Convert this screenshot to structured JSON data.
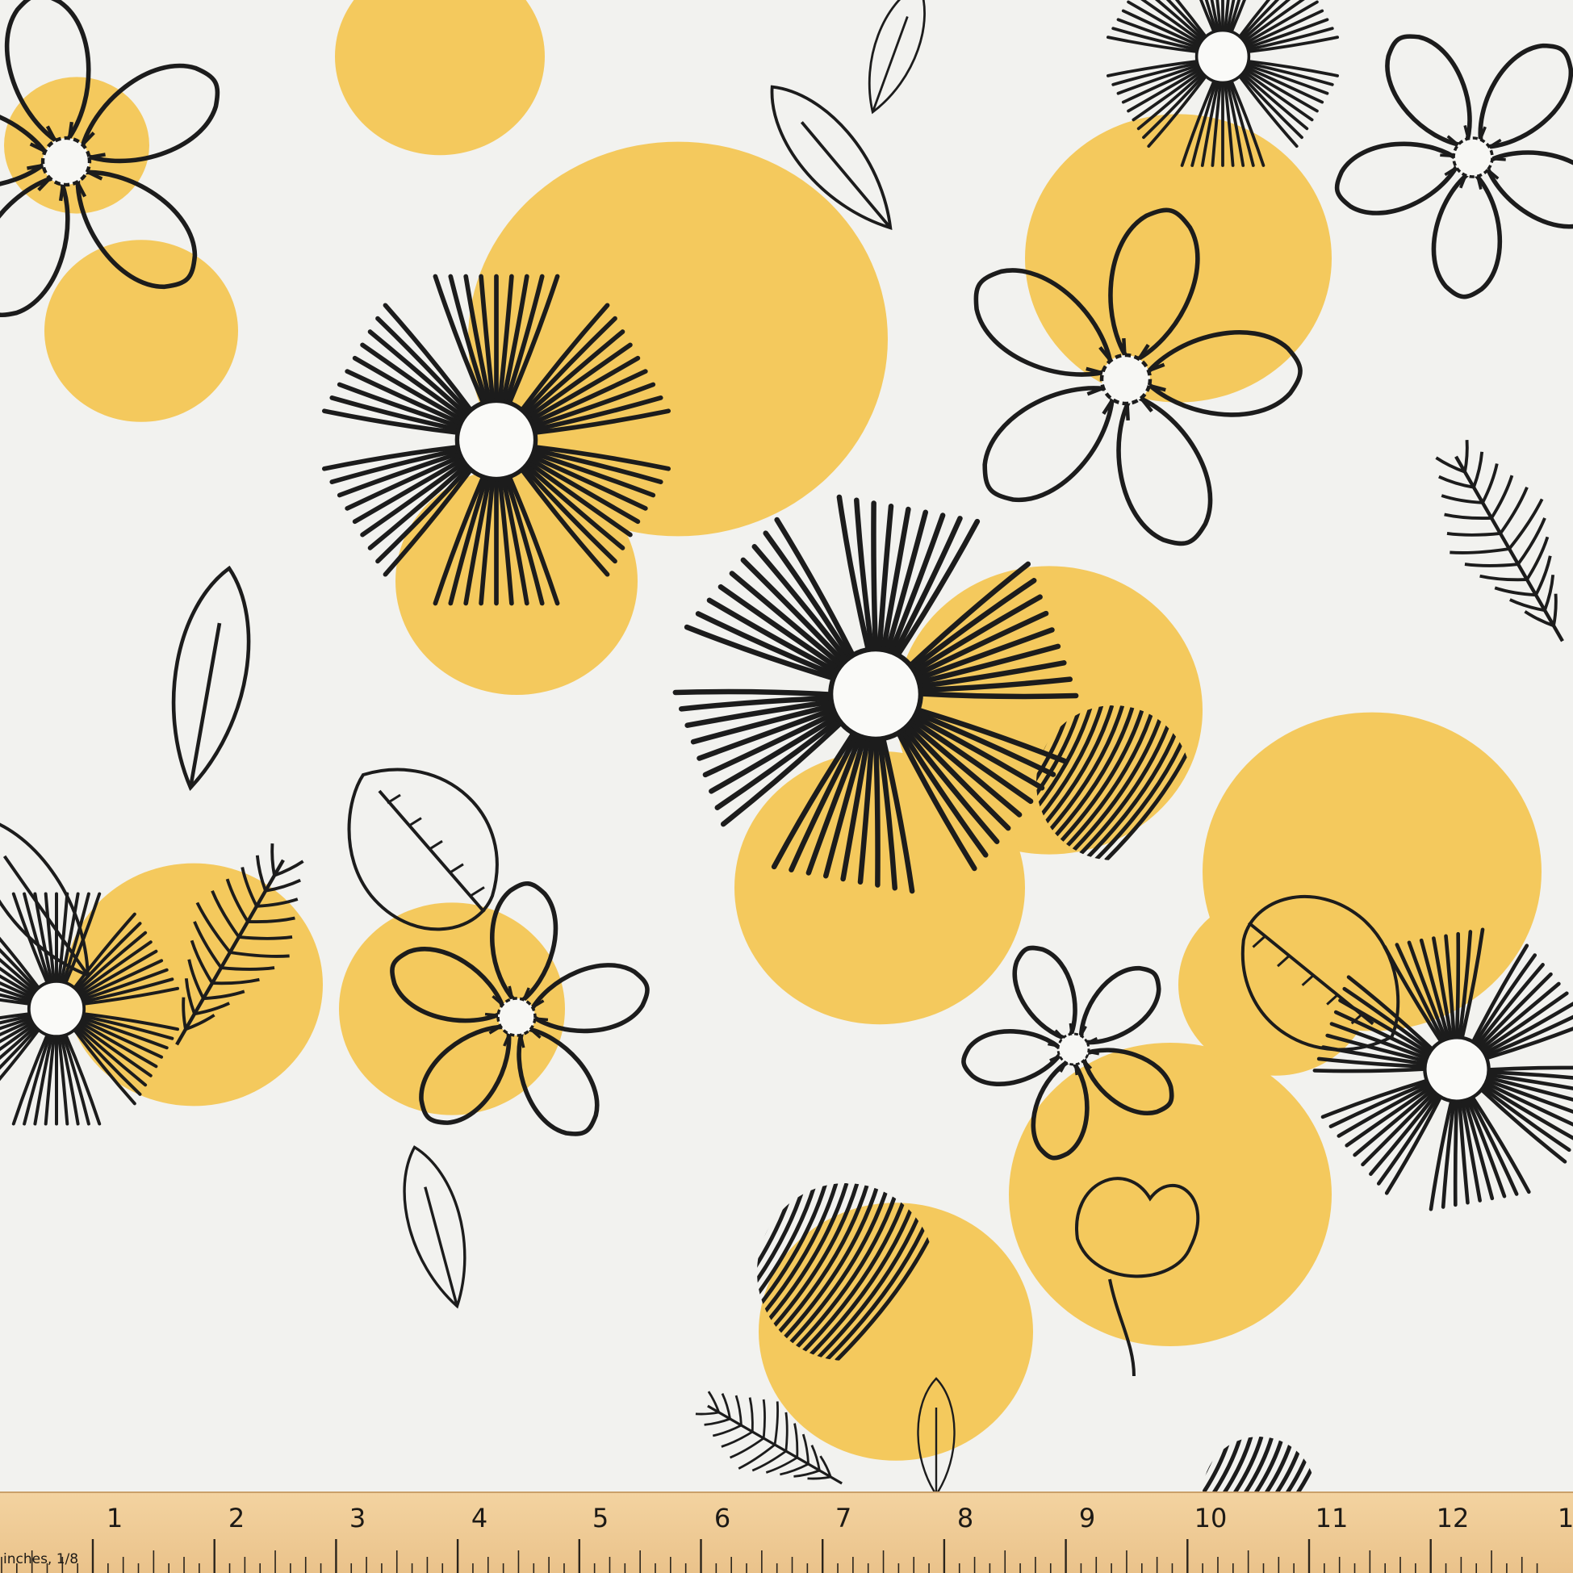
{
  "fabric": {
    "colors": {
      "background": "#f2f2ef",
      "accent": "#f4c95d",
      "ink": "#1c1c1c"
    },
    "motifs": [
      "striped-daisy",
      "outline-flower",
      "leaf",
      "feather-leaf",
      "striped-circle",
      "yellow-dot",
      "rose-bud"
    ]
  },
  "ruler": {
    "unit_label": "inches, 1/8",
    "numbers": [
      "1",
      "2",
      "3",
      "4",
      "5",
      "6",
      "7",
      "8",
      "9",
      "10",
      "11",
      "12",
      "1"
    ]
  }
}
